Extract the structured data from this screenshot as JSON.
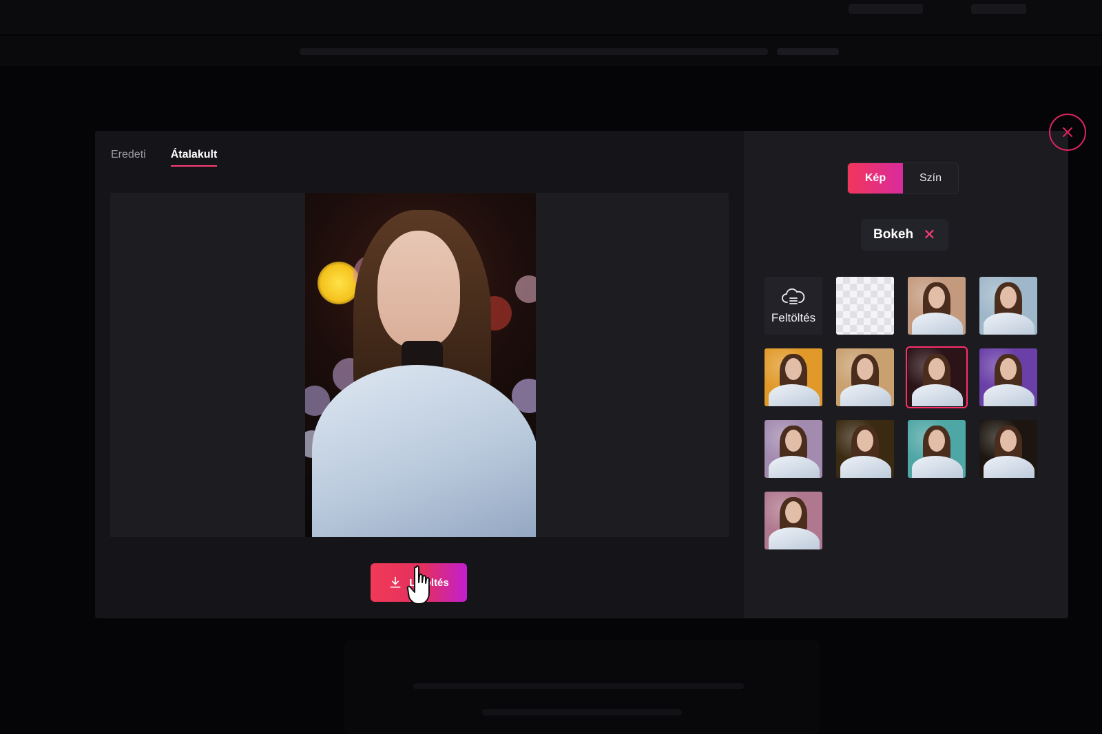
{
  "modal": {
    "tabs": [
      {
        "label": "Eredeti",
        "active": false
      },
      {
        "label": "Átalakult",
        "active": true
      }
    ],
    "download_label": "Letöltés",
    "background_mode": {
      "options": [
        {
          "label": "Kép",
          "active": true
        },
        {
          "label": "Szín",
          "active": false
        }
      ]
    },
    "category": {
      "label": "Bokeh",
      "clear_icon": "close-icon"
    },
    "upload_tile_label": "Feltöltés",
    "upload_icon": "cloud-upload-icon",
    "background_tiles": [
      {
        "kind": "transparent"
      },
      {
        "kind": "image",
        "bg": "#c49a7e"
      },
      {
        "kind": "image",
        "bg": "#9fb8c9"
      },
      {
        "kind": "image",
        "bg": "#e19a2a"
      },
      {
        "kind": "image",
        "bg": "#c9a070"
      },
      {
        "kind": "image",
        "bg": "#2b1318",
        "selected": true
      },
      {
        "kind": "image",
        "bg": "#6a3fa8"
      },
      {
        "kind": "image",
        "bg": "#a38bb0"
      },
      {
        "kind": "image",
        "bg": "#3a2a12"
      },
      {
        "kind": "image",
        "bg": "#4fa7a5"
      },
      {
        "kind": "image",
        "bg": "#1d1610"
      },
      {
        "kind": "image",
        "bg": "#b0788e"
      }
    ]
  },
  "colors": {
    "accent": "#ff2f6a",
    "accent_gradient_end": "#c21fd0",
    "modal_bg": "#151519",
    "panel_bg": "#1b1b20"
  },
  "icons": {
    "close": "close-icon",
    "download": "download-icon",
    "cursor": "hand-pointer-icon"
  }
}
